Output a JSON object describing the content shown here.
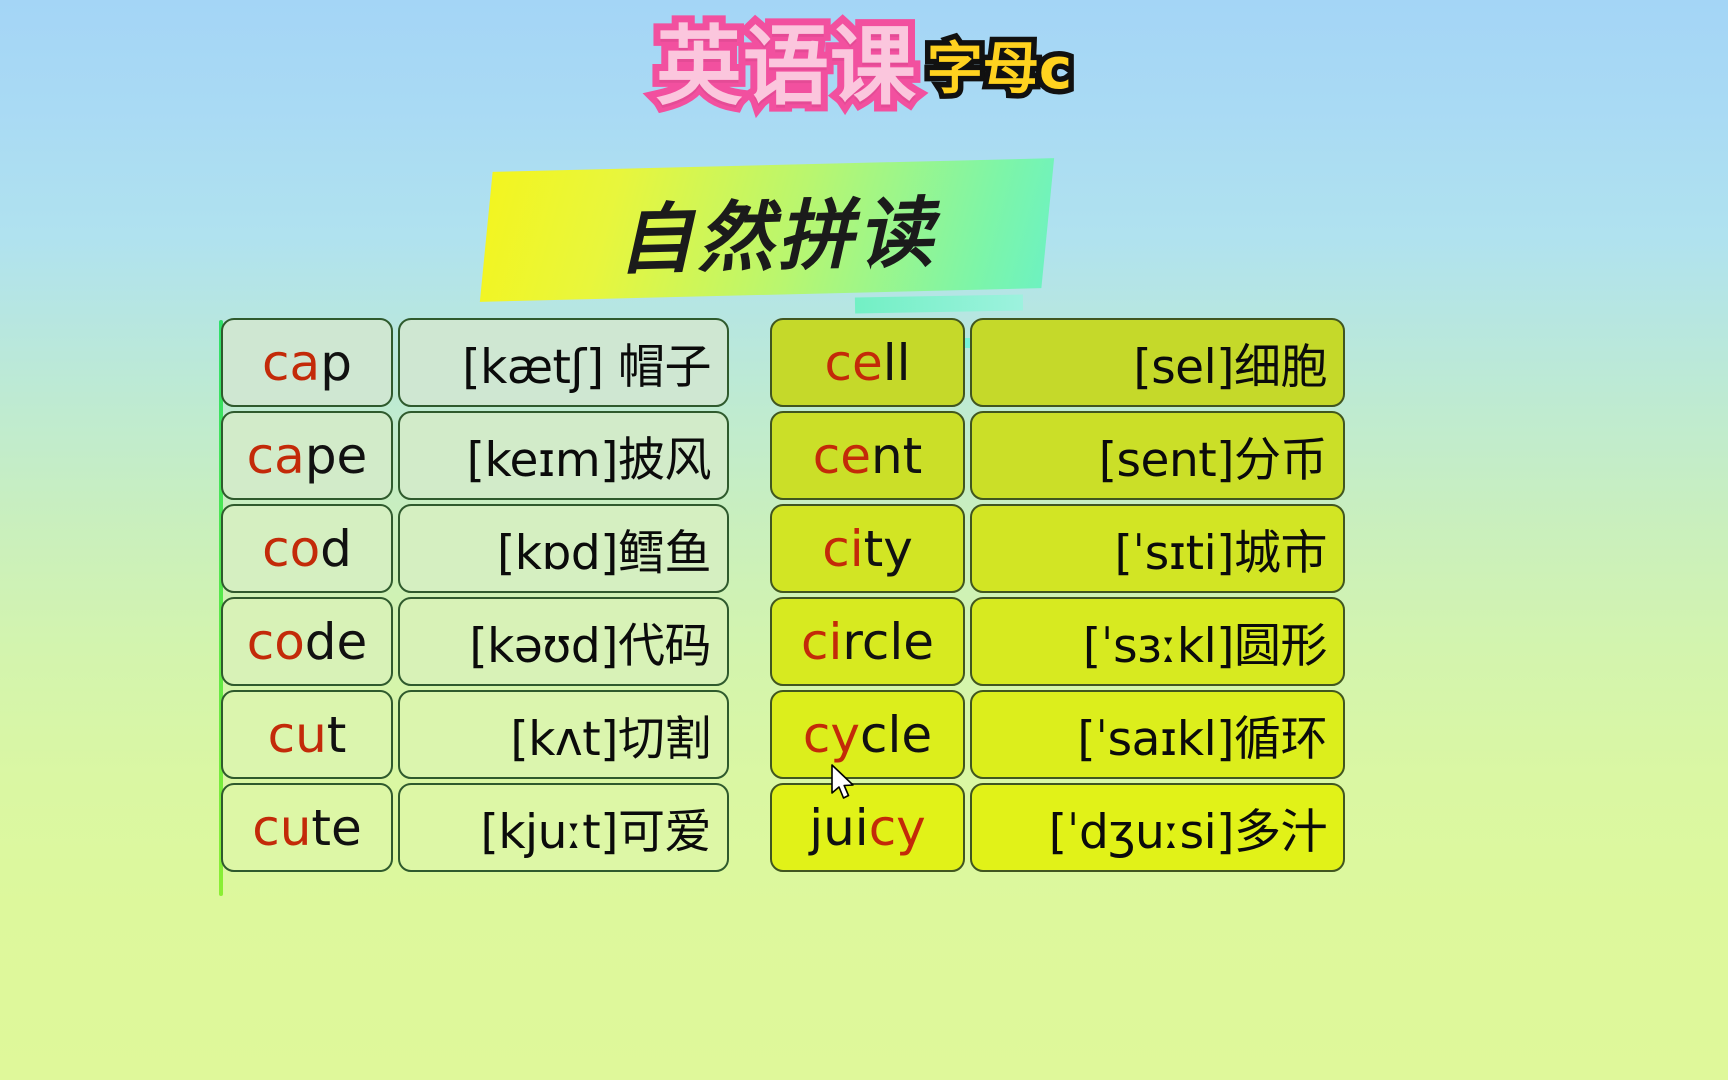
{
  "header": {
    "title_main": "英语课",
    "title_sub": "字母c",
    "banner_text": "自然拼读",
    "colors": {
      "title_main_fill": "#fbc6dd",
      "title_main_stroke": "#f2509f",
      "title_sub_fill": "#ffd21f",
      "title_sub_stroke": "#111111",
      "banner_gradient_start": "#f3f520",
      "banner_gradient_end": "#6ef2c0",
      "highlight_letters": "#c32a09",
      "accent_bar": "#77f2d6"
    }
  },
  "tables": {
    "left": {
      "rows": [
        {
          "word_hl": "ca",
          "word_rest": "p",
          "definition": "[kætʃ] 帽子"
        },
        {
          "word_hl": "ca",
          "word_rest": "pe",
          "definition": "[keɪm]披风"
        },
        {
          "word_hl": "co",
          "word_rest": "d",
          "definition": "[kɒd]鳕鱼"
        },
        {
          "word_hl": "co",
          "word_rest": "de",
          "definition": "[kəʊd]代码"
        },
        {
          "word_hl": "cu",
          "word_rest": "t",
          "definition": "[kʌt]切割"
        },
        {
          "word_hl": "cu",
          "word_rest": "te",
          "definition": "[kjuːt]可爱"
        }
      ]
    },
    "right": {
      "rows": [
        {
          "word_pre": "",
          "word_hl": "ce",
          "word_rest": "ll",
          "definition": "[sel]细胞"
        },
        {
          "word_pre": "",
          "word_hl": "ce",
          "word_rest": "nt",
          "definition": "[sent]分币"
        },
        {
          "word_pre": "",
          "word_hl": "ci",
          "word_rest": "ty",
          "definition": "[ˈsɪti]城市"
        },
        {
          "word_pre": "",
          "word_hl": "ci",
          "word_rest": "rcle",
          "definition": "[ˈsɜːkl]圆形"
        },
        {
          "word_pre": "",
          "word_hl": "cy",
          "word_rest": "cle",
          "definition": "[ˈsaɪkl]循环"
        },
        {
          "word_pre": "jui",
          "word_hl": "cy",
          "word_rest": "",
          "definition": "[ˈdʒuːsi]多汁"
        }
      ]
    }
  },
  "cursor": {
    "name": "mouse-pointer"
  }
}
